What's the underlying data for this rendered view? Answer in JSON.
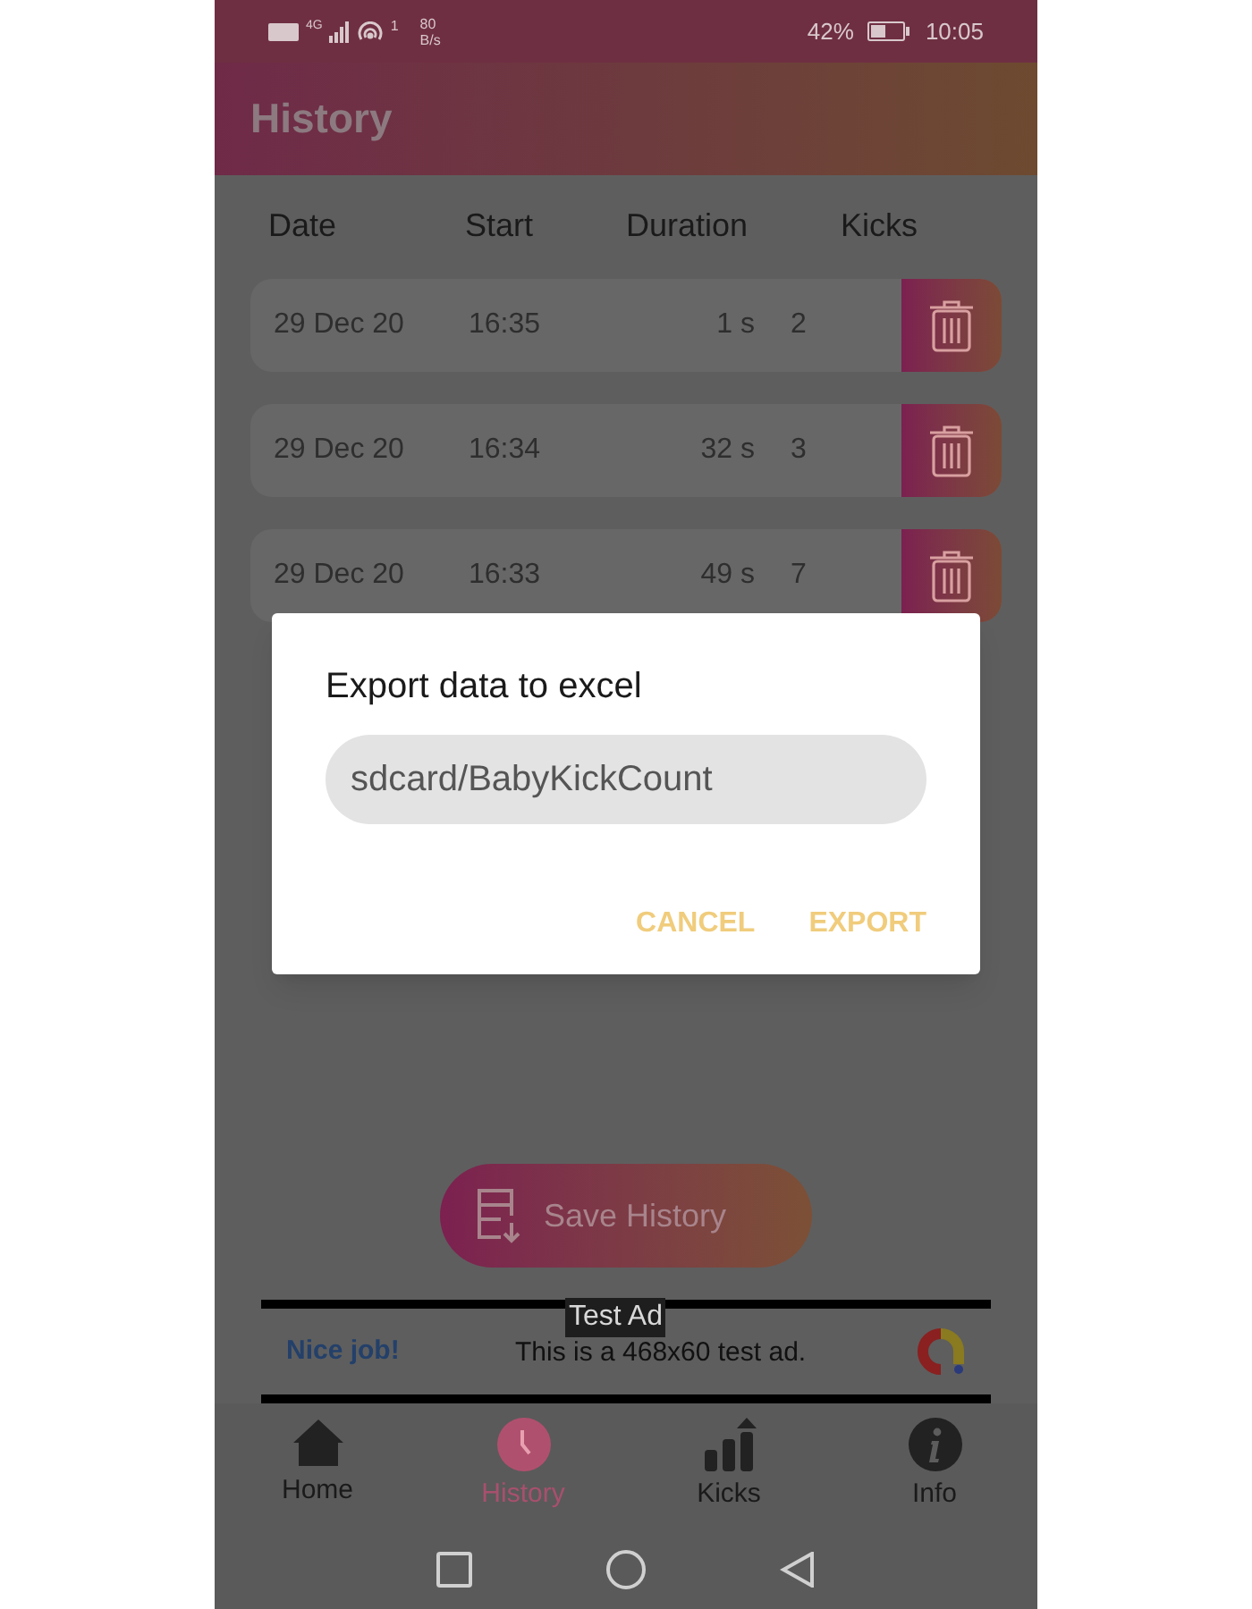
{
  "status_bar": {
    "network": "4G",
    "hotspot_count": "1",
    "speed_value": "80",
    "speed_unit": "B/s",
    "battery": "42%",
    "time": "10:05"
  },
  "header": {
    "title": "History"
  },
  "table": {
    "columns": [
      "Date",
      "Start",
      "Duration",
      "Kicks"
    ],
    "rows": [
      {
        "date": "29 Dec 20",
        "start": "16:35",
        "duration": "1 s",
        "kicks": "2"
      },
      {
        "date": "29 Dec 20",
        "start": "16:34",
        "duration": "32 s",
        "kicks": "3"
      },
      {
        "date": "29 Dec 20",
        "start": "16:33",
        "duration": "49 s",
        "kicks": "7"
      }
    ]
  },
  "save_button": {
    "label": "Save History"
  },
  "ad": {
    "badge": "Test Ad",
    "headline": "Nice job!",
    "text": "This is a 468x60 test ad."
  },
  "nav": [
    {
      "label": "Home",
      "selected": false
    },
    {
      "label": "History",
      "selected": true
    },
    {
      "label": "Kicks",
      "selected": false
    },
    {
      "label": "Info",
      "selected": false
    }
  ],
  "dialog": {
    "title": "Export data to excel",
    "value": "sdcard/BabyKickCount",
    "buttons": [
      "CANCEL",
      "EXPORT"
    ]
  }
}
